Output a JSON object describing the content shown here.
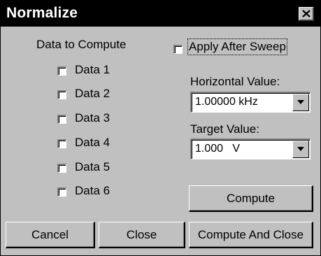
{
  "window": {
    "title": "Normalize"
  },
  "icons": {
    "close": "close-icon",
    "dropdown": "chevron-down-icon"
  },
  "data_section": {
    "heading": "Data to Compute",
    "items": [
      {
        "label": "Data 1",
        "checked": false
      },
      {
        "label": "Data 2",
        "checked": false
      },
      {
        "label": "Data 3",
        "checked": false
      },
      {
        "label": "Data 4",
        "checked": false
      },
      {
        "label": "Data 5",
        "checked": false
      },
      {
        "label": "Data 6",
        "checked": false
      }
    ]
  },
  "apply_after_sweep": {
    "label": "Apply After Sweep",
    "checked": false
  },
  "horizontal_value": {
    "label": "Horizontal Value:",
    "value": "1.00000 kHz"
  },
  "target_value": {
    "label": "Target Value:",
    "value": "1.000   V"
  },
  "buttons": {
    "compute": "Compute",
    "cancel": "Cancel",
    "close": "Close",
    "compute_and_close": "Compute And Close"
  }
}
